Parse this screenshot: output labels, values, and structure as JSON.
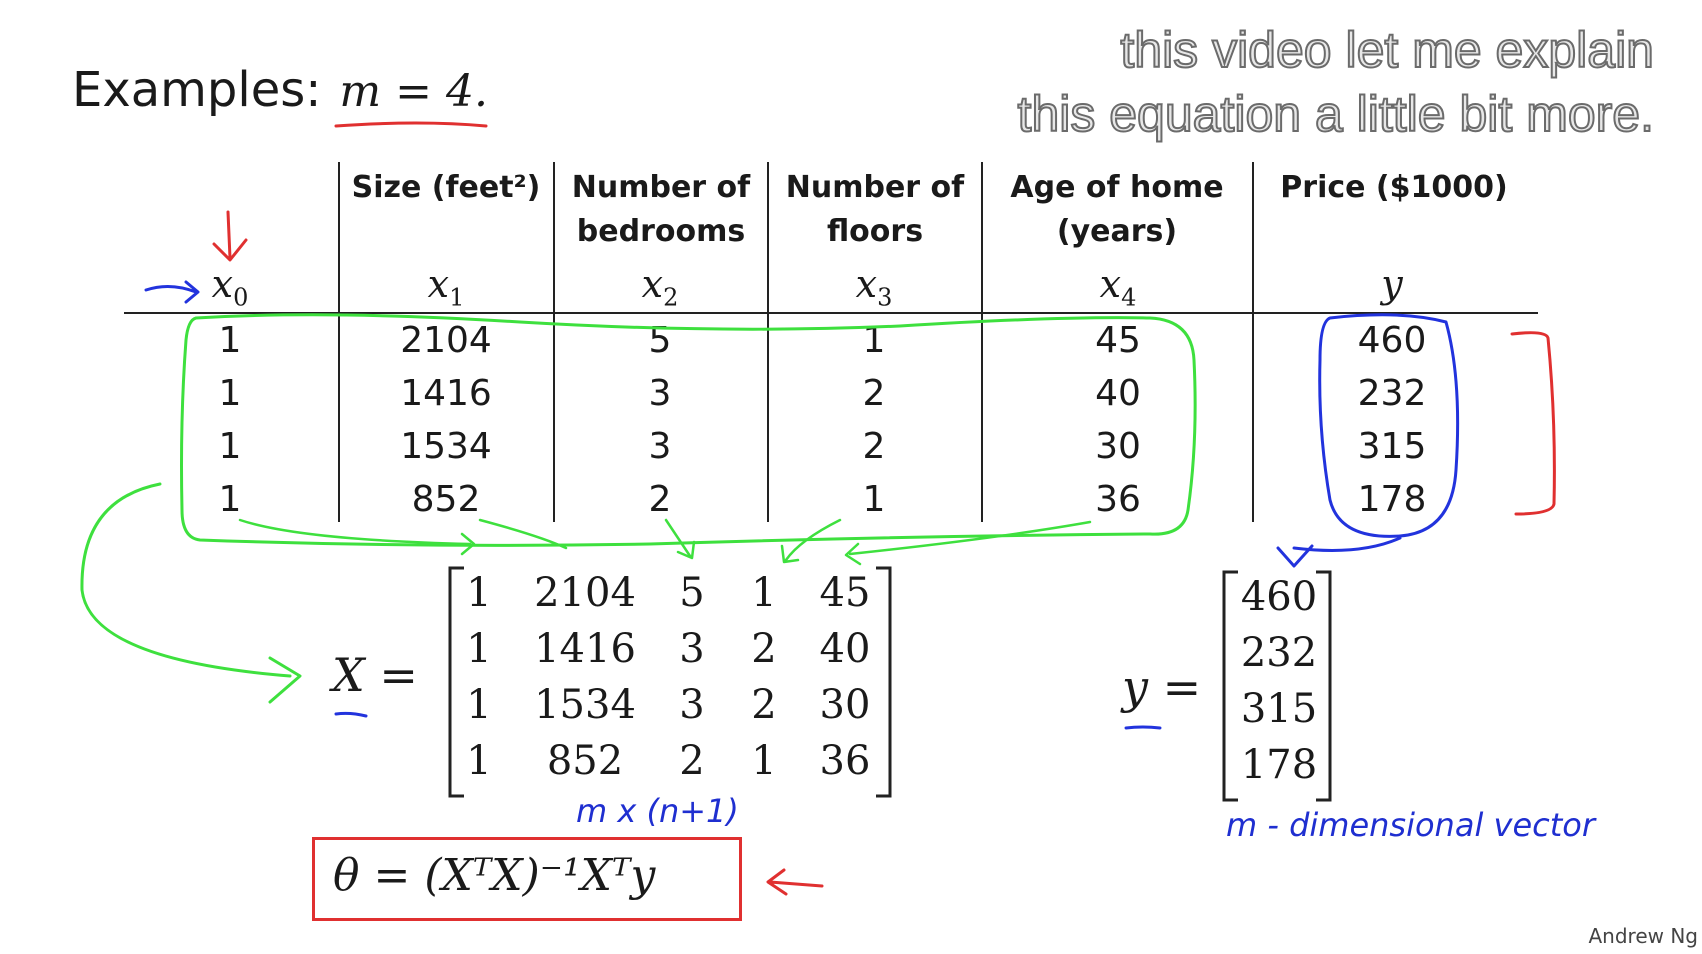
{
  "caption": {
    "line1": "this video let me explain",
    "line2": "this equation a little bit more."
  },
  "examples": {
    "label": "Examples:",
    "value": "m = 4."
  },
  "table": {
    "headers": [
      "",
      "Size (feet²)",
      "Number of bedrooms",
      "Number of floors",
      "Age of home (years)",
      "Price ($1000)"
    ],
    "headers_split": [
      [
        "",
        ""
      ],
      [
        "Size (feet²)",
        ""
      ],
      [
        "Number of",
        "bedrooms"
      ],
      [
        "Number of",
        "floors"
      ],
      [
        "Age of home",
        "(years)"
      ],
      [
        "Price ($1000)",
        ""
      ]
    ],
    "vars": [
      {
        "base": "x",
        "sub": "0"
      },
      {
        "base": "x",
        "sub": "1"
      },
      {
        "base": "x",
        "sub": "2"
      },
      {
        "base": "x",
        "sub": "3"
      },
      {
        "base": "x",
        "sub": "4"
      },
      {
        "base": "y",
        "sub": ""
      }
    ],
    "rows": [
      [
        "1",
        "2104",
        "5",
        "1",
        "45",
        "460"
      ],
      [
        "1",
        "1416",
        "3",
        "2",
        "40",
        "232"
      ],
      [
        "1",
        "1534",
        "3",
        "2",
        "30",
        "315"
      ],
      [
        "1",
        "852",
        "2",
        "1",
        "36",
        "178"
      ]
    ]
  },
  "matrix_X": {
    "symbol": "X",
    "eq": "=",
    "rows": [
      [
        "1",
        "2104",
        "5",
        "1",
        "45"
      ],
      [
        "1",
        "1416",
        "3",
        "2",
        "40"
      ],
      [
        "1",
        "1534",
        "3",
        "2",
        "30"
      ],
      [
        "1",
        "852",
        "2",
        "1",
        "36"
      ]
    ]
  },
  "vector_y": {
    "symbol": "y",
    "eq": "=",
    "values": [
      "460",
      "232",
      "315",
      "178"
    ]
  },
  "annotations": {
    "dims": "m x (n+1)",
    "mdim": "m - dimensional vector"
  },
  "formula": "θ = (XᵀX)⁻¹Xᵀy",
  "credit": "Andrew Ng",
  "colors": {
    "green": "#3ee03e",
    "blue": "#2233dd",
    "red": "#e03030"
  }
}
